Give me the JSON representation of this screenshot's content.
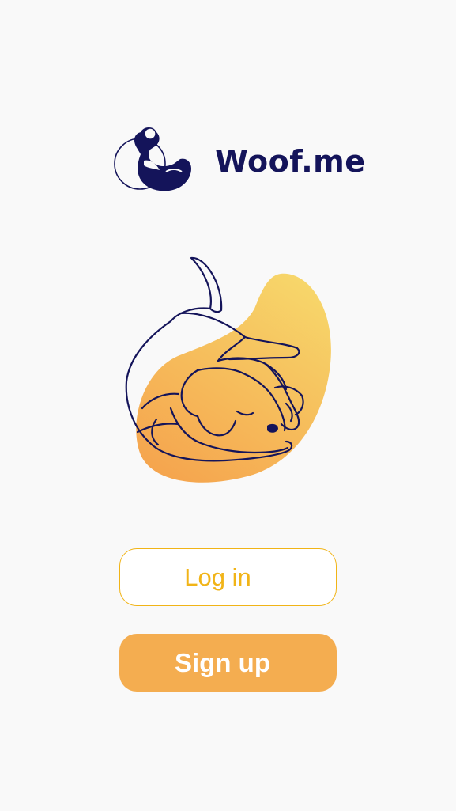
{
  "app": {
    "brand_name": "Woof.me"
  },
  "actions": {
    "login_label": "Log in",
    "signup_label": "Sign up"
  },
  "icons": {
    "logo": "dog-logo-icon",
    "illustration": "sleeping-dog-illustration"
  },
  "colors": {
    "background": "#f9f9f9",
    "brand_navy": "#14145a",
    "accent_yellow": "#f1b417",
    "signup_fill": "#f4ad50",
    "blob_gradient_top": "#f7d66a",
    "blob_gradient_bottom": "#f5a54e"
  }
}
